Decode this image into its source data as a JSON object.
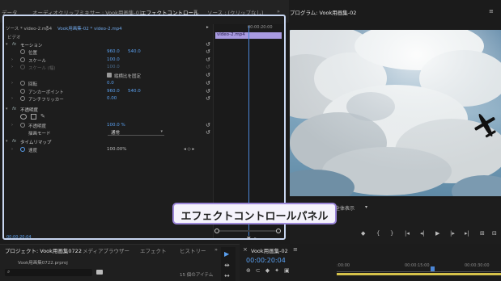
{
  "top_tabs": {
    "data": "データ",
    "audio_mixer": "オーディオクリップミキサー : Vook用画集-01",
    "effect_controls": "エフェクトコントロール",
    "effect_controls_menu": "≡",
    "source": "ソース : (クリップなし)",
    "expand": "»"
  },
  "effect_controls": {
    "source_clip": "ソース * video-2.mp4",
    "caret": "▾",
    "sequence_clip": "Vook用画集-02 * video-2.mp4",
    "play_button": "▸",
    "section_label": "ビデオ",
    "motion": {
      "label": "モーション",
      "position": {
        "label": "位置",
        "x": "960.0",
        "y": "540.0"
      },
      "scale": {
        "label": "スケール",
        "value": "100.0"
      },
      "scale_width": {
        "label": "スケール (幅)",
        "value": "100.0"
      },
      "uniform_scale": {
        "label": "縦横比を固定",
        "checked": true
      },
      "rotation": {
        "label": "回転",
        "value": "0.0"
      },
      "anchor_point": {
        "label": "アンカーポイント",
        "x": "960.0",
        "y": "540.0"
      },
      "anti_flicker": {
        "label": "アンチフリッカー",
        "value": "0.00"
      }
    },
    "opacity": {
      "label": "不透明度",
      "value_label": "不透明度",
      "value": "100.0 %",
      "blend_mode_label": "描画モード",
      "blend_mode": "通常"
    },
    "time_remap": {
      "label": "タイムリマップ",
      "speed_label": "速度",
      "speed_value": "100.00%",
      "keyframe_nav": "◂ ◇ ▸"
    },
    "reset_glyph": "↺",
    "timeline_time": "00:00:20:00",
    "clip_label": "video-2.mp4",
    "current_time": "00:00:20:04",
    "bottom_tools": "▼ ⇥"
  },
  "program_monitor": {
    "tab": "プログラム: Vook用画集-02",
    "menu": "≡",
    "fit_label": "全体表示",
    "fit_caret": "▾",
    "transport": [
      "◆",
      "{",
      "}",
      "|◂",
      "◂|",
      "▶",
      "|▸",
      "▸|",
      "⊞",
      "⊟"
    ]
  },
  "callout": {
    "text": "エフェクトコントロールパネル"
  },
  "project_panel": {
    "tabs": [
      "プロジェクト: Vook用画集0722",
      "メディアブラウザー",
      "エフェクト",
      "ヒストリー"
    ],
    "expand": "»",
    "file_name": "Vook用画集0722.prproj",
    "search_icon": "⌕",
    "item_count": "15 個のアイテム"
  },
  "tools": [
    "▶",
    "⇹",
    "↔"
  ],
  "sequence_panel": {
    "close": "×",
    "tab": "Vook用画集-02",
    "menu": "≡",
    "timecode": "00:00:20:04",
    "ruler": [
      ":00:00",
      "00:00:15:00",
      "00:00:30:00"
    ]
  },
  "colors": {
    "accent_blue": "#5aa0f0",
    "clip_purple": "#a89ae0",
    "callout_border": "#9b86d8",
    "panel_highlight": "#c8d6f0"
  }
}
